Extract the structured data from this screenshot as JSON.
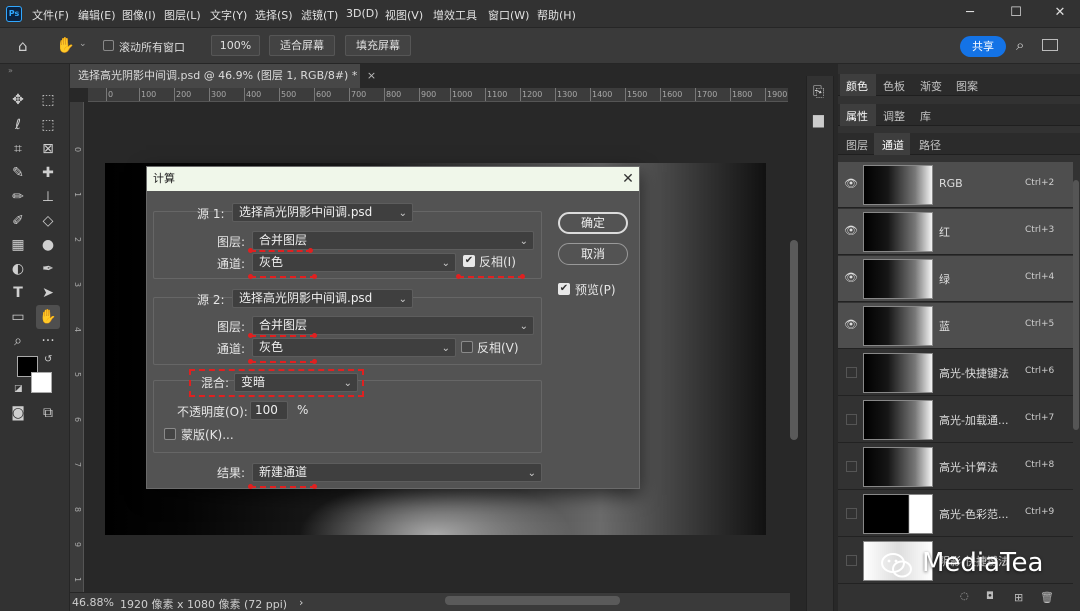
{
  "app": {
    "menu": [
      "文件(F)",
      "编辑(E)",
      "图像(I)",
      "图层(L)",
      "文字(Y)",
      "选择(S)",
      "滤镜(T)",
      "3D(D)",
      "视图(V)",
      "增效工具",
      "窗口(W)",
      "帮助(H)"
    ],
    "logo": "Ps"
  },
  "options": {
    "scroll_all_label": "滚动所有窗口",
    "zoom_value": "100%",
    "fit_screen": "适合屏幕",
    "fill_screen": "填充屏幕",
    "share": "共享"
  },
  "document": {
    "tab_title": "选择高光阴影中间调.psd @ 46.9% (图层 1, RGB/8#) *",
    "tab_close": "×",
    "ruler_h": [
      "0",
      "100",
      "200",
      "300",
      "400",
      "500",
      "600",
      "700",
      "800",
      "900",
      "1000",
      "1100",
      "1200",
      "1300",
      "1400",
      "1500",
      "1600",
      "1700",
      "1800",
      "1900"
    ],
    "ruler_v": [
      "0",
      "1",
      "2",
      "3",
      "4",
      "5",
      "6",
      "7",
      "8",
      "9",
      "1"
    ]
  },
  "status": {
    "zoom": "46.88%",
    "info": "1920 像素 x 1080 像素 (72 ppi)",
    "arrow": "›"
  },
  "panels": {
    "row1_tabs": [
      "颜色",
      "色板",
      "渐变",
      "图案"
    ],
    "row2_tabs": [
      "属性",
      "调整",
      "库"
    ],
    "row3_tabs": [
      "图层",
      "通道",
      "路径"
    ],
    "channels": [
      {
        "name": "RGB",
        "key": "Ctrl+2",
        "visible": true
      },
      {
        "name": "红",
        "key": "Ctrl+3",
        "visible": true
      },
      {
        "name": "绿",
        "key": "Ctrl+4",
        "visible": true
      },
      {
        "name": "蓝",
        "key": "Ctrl+5",
        "visible": true
      },
      {
        "name": "高光-快捷键法",
        "key": "Ctrl+6",
        "visible": false
      },
      {
        "name": "高光-加载通...",
        "key": "Ctrl+7",
        "visible": false
      },
      {
        "name": "高光-计算法",
        "key": "Ctrl+8",
        "visible": false
      },
      {
        "name": "高光-色彩范...",
        "key": "Ctrl+9",
        "visible": false
      },
      {
        "name": "阴影-快捷键法",
        "key": "",
        "visible": false
      }
    ]
  },
  "dialog": {
    "title": "计算",
    "close": "✕",
    "source1_label": "源 1:",
    "source1_file": "选择高光阴影中间调.psd",
    "layer_label": "图层:",
    "layer_value": "合并图层",
    "channel_label": "通道:",
    "channel_value": "灰色",
    "invert_label": "反相(I)",
    "invert1_checked": true,
    "source2_label": "源 2:",
    "source2_file": "选择高光阴影中间调.psd",
    "invert2_label": "反相(V)",
    "invert2_checked": false,
    "blend_label": "混合:",
    "blend_value": "变暗",
    "opacity_label": "不透明度(O):",
    "opacity_value": "100",
    "opacity_unit": "%",
    "mask_label": "蒙版(K)...",
    "result_label": "结果:",
    "result_value": "新建通道",
    "ok": "确定",
    "cancel": "取消",
    "preview": "预览(P)",
    "preview_checked": true
  },
  "watermark": {
    "text": "MediaTea",
    "icon": "wechat-icon"
  }
}
